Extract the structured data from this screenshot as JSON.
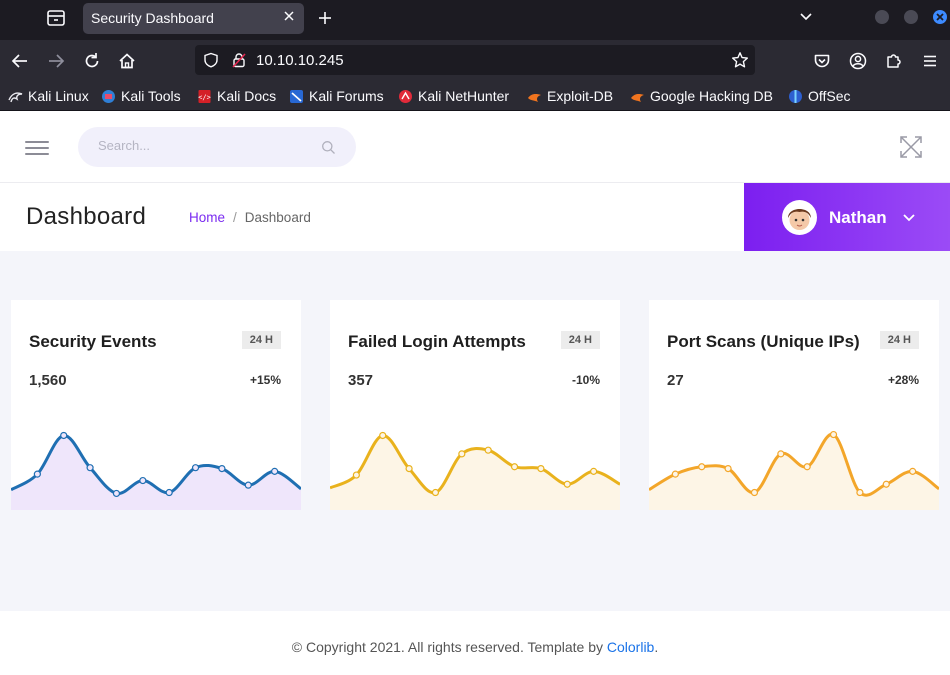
{
  "browser": {
    "tab_title": "Security Dashboard",
    "url": "10.10.10.245",
    "bookmarks": [
      {
        "label": "Kali Linux",
        "icon": "kali-dragon-icon"
      },
      {
        "label": "Kali Tools",
        "icon": "kali-tools-icon"
      },
      {
        "label": "Kali Docs",
        "icon": "kali-docs-icon"
      },
      {
        "label": "Kali Forums",
        "icon": "kali-forums-icon"
      },
      {
        "label": "Kali NetHunter",
        "icon": "nethunter-icon"
      },
      {
        "label": "Exploit-DB",
        "icon": "exploit-db-icon"
      },
      {
        "label": "Google Hacking DB",
        "icon": "ghdb-icon"
      },
      {
        "label": "OffSec",
        "icon": "offsec-icon"
      }
    ]
  },
  "header": {
    "search_placeholder": "Search..."
  },
  "page": {
    "title": "Dashboard",
    "breadcrumb_home": "Home",
    "breadcrumb_sep": "/",
    "breadcrumb_current": "Dashboard"
  },
  "user": {
    "name": "Nathan"
  },
  "cards": [
    {
      "title": "Security Events",
      "badge": "24 H",
      "value": "1,560",
      "change": "+15%",
      "color": "#1f6fb2",
      "fill": "#efe6fb",
      "points": [
        0.22,
        0.39,
        0.81,
        0.46,
        0.18,
        0.32,
        0.19,
        0.46,
        0.45,
        0.27,
        0.42,
        0.23
      ]
    },
    {
      "title": "Failed Login Attempts",
      "badge": "24 H",
      "value": "357",
      "change": "-10%",
      "color": "#e9b21d",
      "fill": "#fdf5e6",
      "points": [
        0.24,
        0.38,
        0.81,
        0.45,
        0.19,
        0.61,
        0.65,
        0.47,
        0.45,
        0.28,
        0.42,
        0.28
      ]
    },
    {
      "title": "Port Scans (Unique IPs)",
      "badge": "24 H",
      "value": "27",
      "change": "+28%",
      "color": "#f3a62a",
      "fill": "#fdf5e6",
      "points": [
        0.22,
        0.39,
        0.47,
        0.45,
        0.19,
        0.61,
        0.47,
        0.82,
        0.19,
        0.28,
        0.42,
        0.23
      ]
    }
  ],
  "footer": {
    "text": "© Copyright 2021. All rights reserved. Template by",
    "link": "Colorlib",
    "end": "."
  }
}
